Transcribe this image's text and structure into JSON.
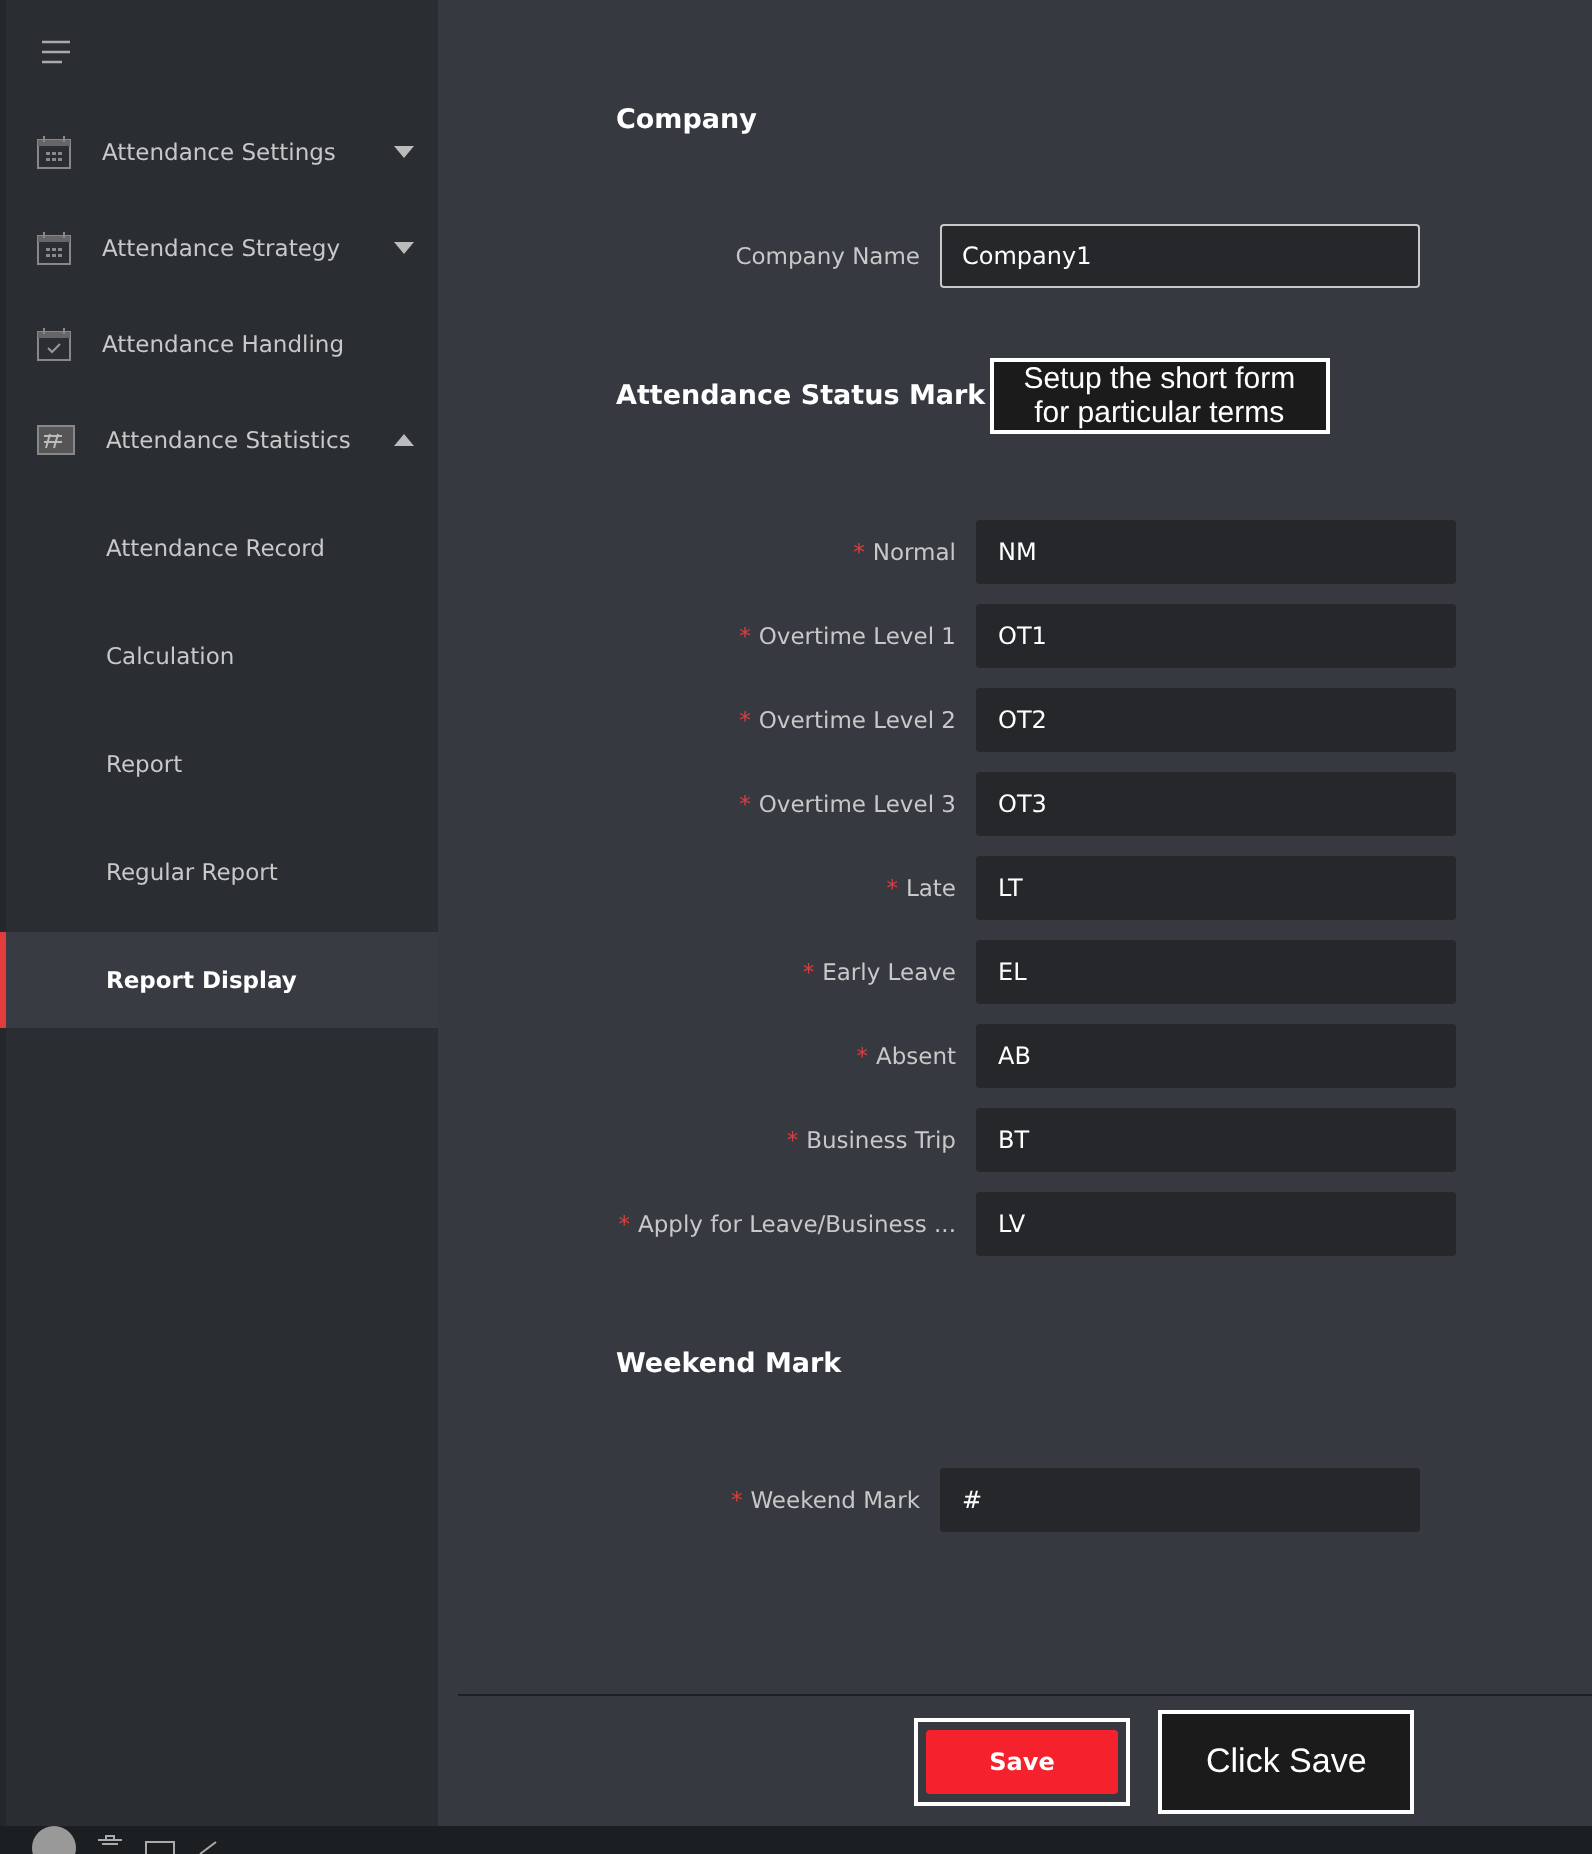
{
  "sidebar": {
    "items": [
      {
        "label": "Attendance Settings",
        "expanded": false
      },
      {
        "label": "Attendance Strategy",
        "expanded": false
      },
      {
        "label": "Attendance Handling"
      },
      {
        "label": "Attendance Statistics",
        "expanded": true,
        "children": [
          {
            "label": "Attendance Record",
            "selected": false
          },
          {
            "label": "Calculation",
            "selected": false
          },
          {
            "label": "Report",
            "selected": false
          },
          {
            "label": "Regular Report",
            "selected": false
          },
          {
            "label": "Report Display",
            "selected": true
          }
        ]
      }
    ]
  },
  "sections": [
    {
      "title": "Company",
      "fields": [
        {
          "label": "Company Name",
          "value": "Company1"
        }
      ]
    },
    {
      "title": "Attendance Status Mark",
      "callout": "Setup the short form for particular terms",
      "fields": [
        {
          "label": "Normal",
          "required": "*",
          "value": "NM"
        },
        {
          "label": "Overtime Level 1",
          "required": "*",
          "value": "OT1"
        },
        {
          "label": "Overtime Level 2",
          "required": "*",
          "value": "OT2"
        },
        {
          "label": "Overtime Level 3",
          "required": "*",
          "value": "OT3"
        },
        {
          "label": "Late",
          "required": "*",
          "value": "LT"
        },
        {
          "label": "Early Leave",
          "required": "*",
          "value": "EL"
        },
        {
          "label": "Absent",
          "required": "*",
          "value": "AB"
        },
        {
          "label": "Business Trip",
          "required": "*",
          "value": "BT"
        },
        {
          "label": "Apply for Leave/Business ...",
          "required": "*",
          "value": "LV"
        }
      ]
    },
    {
      "title": "Weekend Mark",
      "fields": [
        {
          "label": "Weekend Mark",
          "required": "*",
          "value": "#"
        }
      ]
    }
  ],
  "footer": {
    "save_button": "Save",
    "callout": "Click Save"
  }
}
